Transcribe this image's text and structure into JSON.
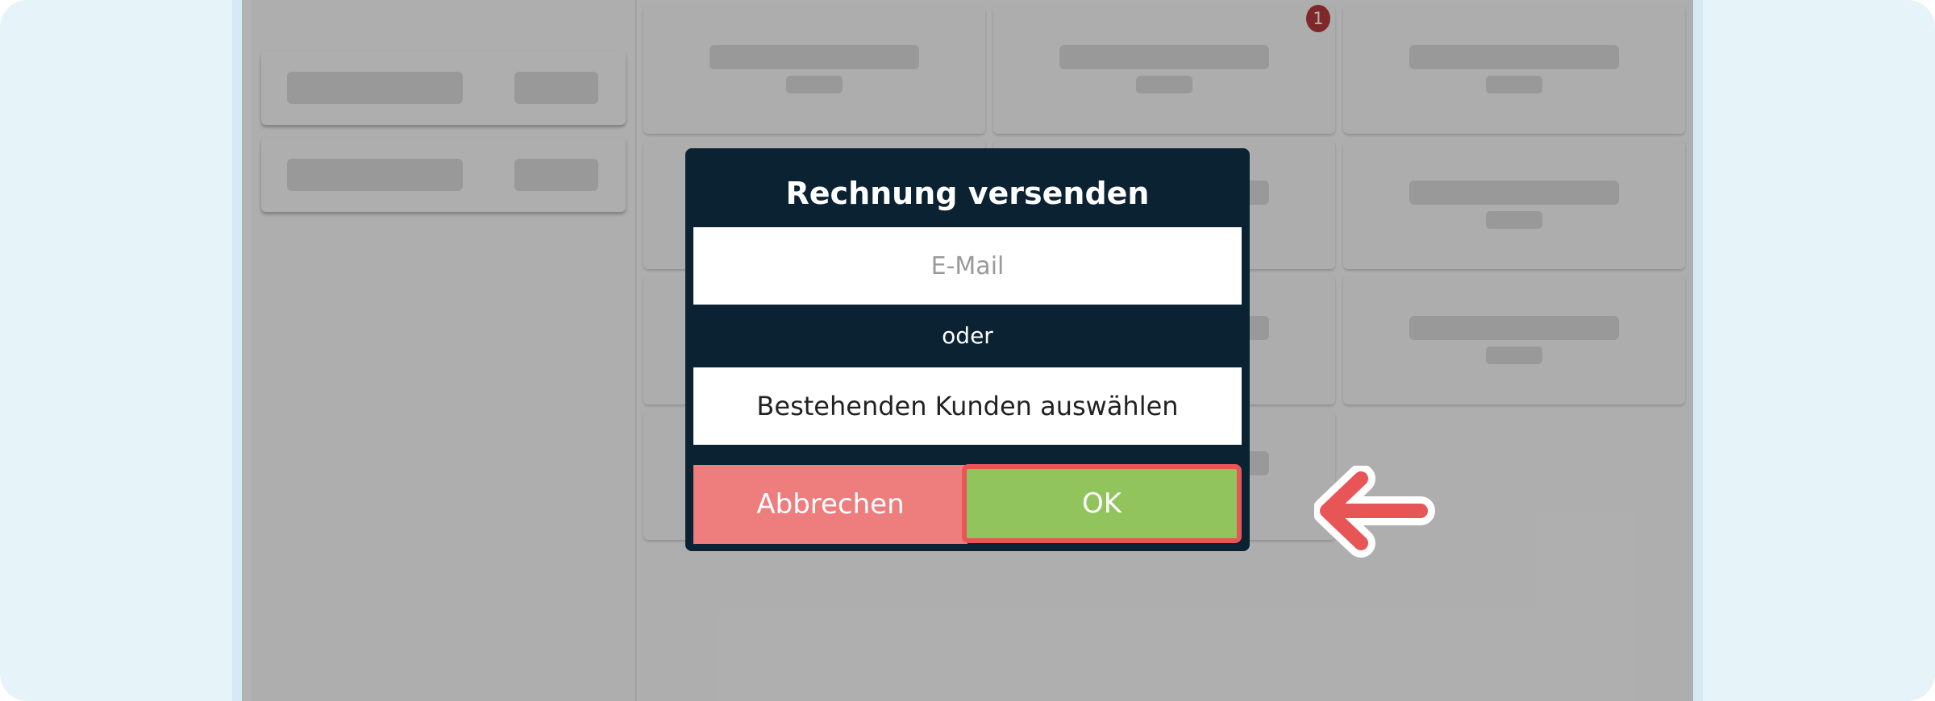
{
  "dialog": {
    "title": "Rechnung versenden",
    "email_placeholder": "E-Mail",
    "separator": "oder",
    "select_customer_label": "Bestehenden Kunden auswählen",
    "cancel_label": "Abbrechen",
    "ok_label": "OK"
  },
  "order_badge": {
    "count": "1"
  },
  "colors": {
    "dialog_background": "#0b2233",
    "cancel_button": "#ee7d7e",
    "ok_button": "#92c45d",
    "highlight": "#e85556",
    "badge": "#b63a3c"
  },
  "icons": {
    "pointer": "arrow-left-icon"
  }
}
